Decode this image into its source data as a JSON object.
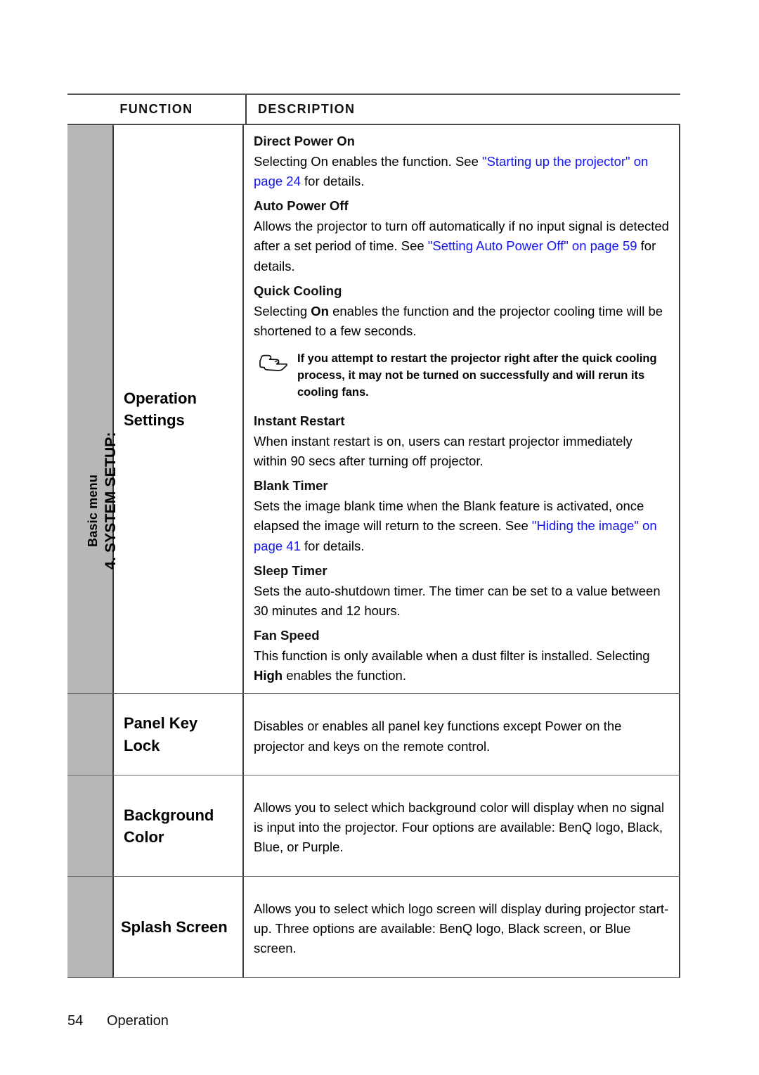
{
  "page": {
    "side_caption_line1": "4. SYSTEM SETUP:",
    "side_caption_line2": "Basic menu",
    "footer_page_number": "54",
    "footer_section": "Operation",
    "link_color": "#1414ef",
    "side_band_color": "#b7b7b7"
  },
  "table": {
    "headers": {
      "function": "FUNCTION",
      "description": "DESCRIPTION"
    },
    "rows": [
      {
        "function_label": "Operation Settings",
        "function_label_line1": "Operation",
        "function_label_line2": "Settings",
        "blocks": [
          {
            "type": "sub",
            "heading": "Direct Power On",
            "body_pre": "Selecting On enables the function. See ",
            "body_link1": "\"Starting up the projector\" on page 24",
            "body_post": " for details."
          },
          {
            "type": "sub",
            "heading": "Auto Power Off",
            "body_pre": "Allows the projector to turn off automatically if no input signal is detected after a set period of time. See ",
            "body_link1": "\"Setting Auto Power Off\" on page 59",
            "body_post": " for details."
          },
          {
            "type": "sub",
            "heading": "Quick Cooling",
            "body_pre": "Selecting ",
            "body_bold": "On",
            "body_post": " enables the function and the projector cooling time will be shortened to a few seconds."
          },
          {
            "type": "note",
            "icon": "pointing-hand-icon",
            "text": "If you attempt to restart the projector right after the quick cooling process, it may not be turned on successfully and will rerun its cooling fans."
          },
          {
            "type": "sub",
            "heading": "Instant Restart",
            "body_pre": "When instant restart is on, users can restart projector immediately within 90 secs after turning off projector.",
            "body_post": ""
          },
          {
            "type": "sub",
            "heading": "Blank Timer",
            "body_pre": "Sets the image blank time when the Blank feature is activated, once elapsed the image will return to the screen. See ",
            "body_link1": "\"Hiding the image\" on page 41",
            "body_post": "  for details."
          },
          {
            "type": "sub",
            "heading": "Sleep Timer",
            "body_pre": "Sets the auto-shutdown timer. The timer can be set to a value between 30 minutes and 12 hours.",
            "body_post": ""
          },
          {
            "type": "sub",
            "heading": "Fan Speed",
            "body_pre": "This function is only available when a dust filter is installed. Selecting ",
            "body_bold": "High",
            "body_post": " enables the function."
          }
        ]
      },
      {
        "function_label_line1": "Panel Key",
        "function_label_line2": "Lock",
        "description": "Disables or enables all panel key functions except Power on the projector and keys on the remote control."
      },
      {
        "function_label_line1": "Background",
        "function_label_line2": "Color",
        "description": "Allows you to select which background color will display when no signal is input into the projector. Four options are available: BenQ logo, Black, Blue, or Purple."
      },
      {
        "function_label_line1": "Splash Screen",
        "function_label_line2": "",
        "description": "Allows you to select which logo screen will display during projector start-up. Three options are available: BenQ logo, Black screen, or Blue screen."
      }
    ]
  }
}
